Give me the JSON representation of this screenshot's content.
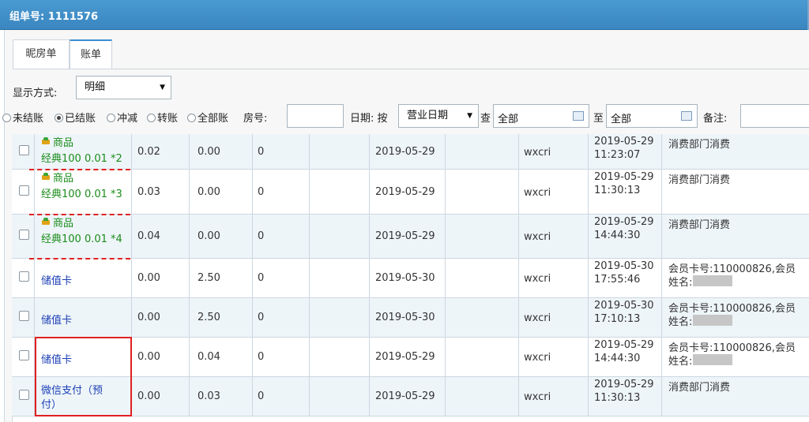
{
  "window": {
    "title": "组单号: 1111576"
  },
  "tabs": [
    {
      "label": "昵房单"
    },
    {
      "label": "账单"
    }
  ],
  "filters": {
    "display_label": "显示方式:",
    "display_value": "明细",
    "radios": [
      "未结账",
      "已结账",
      "冲减",
      "转账",
      "全部账"
    ],
    "selected_radio": "已结账",
    "room_label": "房号:",
    "date_label": "日期: 按",
    "date_type": "营业日期",
    "query_label": "查",
    "from_value": "全部",
    "to_label": "至",
    "to_value": "全部",
    "remark_label": "备注:"
  },
  "rows": [
    {
      "item": "商品",
      "item2": "经典100 0.01 *2",
      "c1": "0.02",
      "c2": "0.00",
      "c3": "0",
      "date": "2019-05-29",
      "user": "wxcri",
      "time": "2019-05-29",
      "time2": "11:23:07",
      "note": "消费部门消费",
      "note2": ""
    },
    {
      "item": "商品",
      "item2": "经典100 0.01 *3",
      "c1": "0.03",
      "c2": "0.00",
      "c3": "0",
      "date": "2019-05-29",
      "user": "wxcri",
      "time": "2019-05-29",
      "time2": "11:30:13",
      "note": "消费部门消费",
      "note2": ""
    },
    {
      "item": "商品",
      "item2": "经典100 0.01 *4",
      "c1": "0.04",
      "c2": "0.00",
      "c3": "0",
      "date": "2019-05-29",
      "user": "wxcri",
      "time": "2019-05-29",
      "time2": "14:44:30",
      "note": "消费部门消费",
      "note2": ""
    },
    {
      "item": "储值卡",
      "item2": "",
      "c1": "0.00",
      "c2": "2.50",
      "c3": "0",
      "date": "2019-05-30",
      "user": "wxcri",
      "time": "2019-05-30",
      "time2": "17:55:46",
      "note": "会员卡号:110000826,会员",
      "note2": "姓名:"
    },
    {
      "item": "储值卡",
      "item2": "",
      "c1": "0.00",
      "c2": "2.50",
      "c3": "0",
      "date": "2019-05-30",
      "user": "wxcri",
      "time": "2019-05-30",
      "time2": "17:10:13",
      "note": "会员卡号:110000826,会员",
      "note2": "姓名:"
    },
    {
      "item": "储值卡",
      "item2": "",
      "c1": "0.00",
      "c2": "0.04",
      "c3": "0",
      "date": "2019-05-29",
      "user": "wxcri",
      "time": "2019-05-29",
      "time2": "14:44:30",
      "note": "会员卡号:110000826,会员",
      "note2": "姓名:"
    },
    {
      "item": "微信支付（预",
      "item2": "付）",
      "c1": "0.00",
      "c2": "0.03",
      "c3": "0",
      "date": "2019-05-29",
      "user": "wxcri",
      "time": "2019-05-29",
      "time2": "11:30:13",
      "note": "消费部门消费",
      "note2": ""
    }
  ]
}
